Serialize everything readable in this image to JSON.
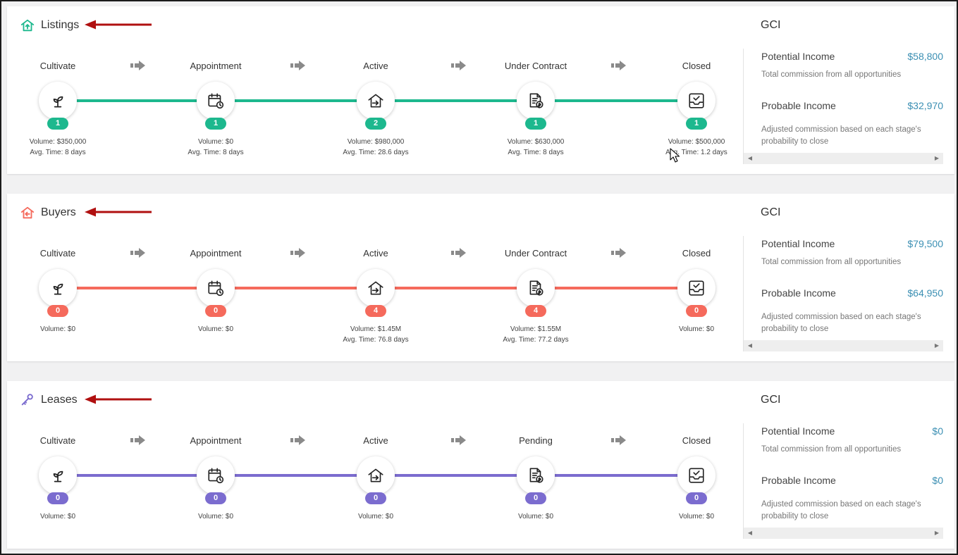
{
  "colors": {
    "listings": "#1db88e",
    "buyers": "#f56a5c",
    "leases": "#7b6ccf",
    "gci_value": "#3b8fb3",
    "annotation_arrow": "#b01010"
  },
  "gci": {
    "title": "GCI",
    "potential_label": "Potential Income",
    "potential_sub": "Total commission from all opportunities",
    "probable_label": "Probable Income",
    "probable_sub": "Adjusted commission based on each stage's probability to close"
  },
  "panels": [
    {
      "key": "listings",
      "title": "Listings",
      "icon": "house-up-icon",
      "stages": [
        {
          "label": "Cultivate",
          "icon": "sprout-icon",
          "count": "1",
          "stats": [
            "Volume: $350,000",
            "Avg. Time: 8 days"
          ]
        },
        {
          "label": "Appointment",
          "icon": "calendar-clock-icon",
          "count": "1",
          "stats": [
            "Volume: $0",
            "Avg. Time: 8 days"
          ]
        },
        {
          "label": "Active",
          "icon": "house-arrow-icon",
          "count": "2",
          "stats": [
            "Volume: $980,000",
            "Avg. Time: 28.6 days"
          ]
        },
        {
          "label": "Under Contract",
          "icon": "contract-dollar-icon",
          "count": "1",
          "stats": [
            "Volume: $630,000",
            "Avg. Time: 8 days"
          ]
        },
        {
          "label": "Closed",
          "icon": "inbox-check-icon",
          "count": "1",
          "stats": [
            "Volume: $500,000",
            "Avg. Time: 1.2 days"
          ]
        }
      ],
      "potential_value": "$58,800",
      "probable_value": "$32,970"
    },
    {
      "key": "buyers",
      "title": "Buyers",
      "icon": "house-left-icon",
      "stages": [
        {
          "label": "Cultivate",
          "icon": "sprout-icon",
          "count": "0",
          "stats": [
            "Volume: $0"
          ]
        },
        {
          "label": "Appointment",
          "icon": "calendar-clock-icon",
          "count": "0",
          "stats": [
            "Volume: $0"
          ]
        },
        {
          "label": "Active",
          "icon": "house-arrow-icon",
          "count": "4",
          "stats": [
            "Volume: $1.45M",
            "Avg. Time: 76.8 days"
          ]
        },
        {
          "label": "Under Contract",
          "icon": "contract-dollar-icon",
          "count": "4",
          "stats": [
            "Volume: $1.55M",
            "Avg. Time: 77.2 days"
          ]
        },
        {
          "label": "Closed",
          "icon": "inbox-check-icon",
          "count": "0",
          "stats": [
            "Volume: $0"
          ]
        }
      ],
      "potential_value": "$79,500",
      "probable_value": "$64,950"
    },
    {
      "key": "leases",
      "title": "Leases",
      "icon": "key-icon",
      "stages": [
        {
          "label": "Cultivate",
          "icon": "sprout-icon",
          "count": "0",
          "stats": [
            "Volume: $0"
          ]
        },
        {
          "label": "Appointment",
          "icon": "calendar-clock-icon",
          "count": "0",
          "stats": [
            "Volume: $0"
          ]
        },
        {
          "label": "Active",
          "icon": "house-arrow-icon",
          "count": "0",
          "stats": [
            "Volume: $0"
          ]
        },
        {
          "label": "Pending",
          "icon": "contract-dollar-icon",
          "count": "0",
          "stats": [
            "Volume: $0"
          ]
        },
        {
          "label": "Closed",
          "icon": "inbox-check-icon",
          "count": "0",
          "stats": [
            "Volume: $0"
          ]
        }
      ],
      "potential_value": "$0",
      "probable_value": "$0"
    }
  ]
}
